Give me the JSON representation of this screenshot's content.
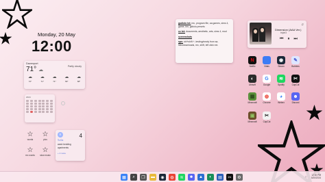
{
  "clock": {
    "date": "Monday, 20 May",
    "time": "12:00"
  },
  "weather": {
    "location": "Davenport",
    "temp": "71°",
    "condition": "Partly cloudy",
    "icon": "partly-cloudy-icon",
    "forecast": [
      {
        "label": "72°",
        "icon": "cloud-icon"
      },
      {
        "label": "71°",
        "icon": "cloud-icon"
      },
      {
        "label": "71°",
        "icon": "cloud-icon"
      },
      {
        "label": "69°",
        "icon": "cloud-icon"
      },
      {
        "label": "68°",
        "icon": "cloud-icon"
      }
    ]
  },
  "calendar": {
    "header": "2024",
    "today_index": 29
  },
  "star_grid": {
    "items": [
      {
        "label": "words",
        "icon": "star-icon"
      },
      {
        "label": "pics",
        "icon": "star-icon"
      },
      {
        "label": "rec words",
        "icon": "star-icon"
      },
      {
        "label": "slow music",
        "icon": "star-icon"
      }
    ]
  },
  "reminder": {
    "count": "4",
    "list_name": "To Do",
    "items": [
      "wash bedding",
      "apartments"
    ],
    "more": "+ 2 more"
  },
  "notes": {
    "lines": [
      {
        "head": "gudiolo txt:",
        "body": "rec, program file, aa games, sims 4, game, bin, gidiolo presets"
      },
      {
        "head": "cc txt:",
        "body": "documents, aesthetic, arts, sims 4, mod"
      },
      {
        "head": "screenshots",
        "body": ""
      },
      {
        "head": "sps:",
        "body": "ctrl+shift +, testing/newly from sa-files/downloads, rec, shift, left click ext."
      }
    ]
  },
  "music": {
    "title": "Dimension (AAA Ver.)",
    "artist": "triple3",
    "note_icon": "music-note-icon",
    "controls": [
      "previous-icon",
      "pause-icon",
      "next-icon"
    ]
  },
  "desktop_icons": [
    {
      "label": "Netflix",
      "color": "#111111",
      "glyph": "N",
      "fg": "#e50914"
    },
    {
      "label": "Vitals",
      "color": "#3d7cf5",
      "glyph": "",
      "fg": "#ffffff"
    },
    {
      "label": "Steam",
      "color": "#1b2838",
      "glyph": "◉",
      "fg": "#ffffff"
    },
    {
      "label": "Bubbles",
      "color": "#dfe6ff",
      "glyph": "✎",
      "fg": "#4a5bd1"
    },
    {
      "label": "Ubisoft",
      "color": "#2b2b2b",
      "glyph": "◐",
      "fg": "#ffffff"
    },
    {
      "label": "Google",
      "color": "#ffffff",
      "glyph": "G",
      "fg": "#3b82f6"
    },
    {
      "label": "Spotify",
      "color": "#1ed760",
      "glyph": "≋",
      "fg": "#ffffff"
    },
    {
      "label": "CapCut",
      "color": "#111111",
      "glyph": "✂",
      "fg": "#ffffff"
    },
    {
      "label": "Minecraft",
      "color": "#5a8f3c",
      "glyph": "▦",
      "fg": "#2d4a1c"
    },
    {
      "label": "Chrome",
      "color": "#ffffff",
      "glyph": "◍",
      "fg": "#ea4335"
    },
    {
      "label": "Webex",
      "color": "#ffffff",
      "glyph": "◕",
      "fg": "#3b82f6"
    },
    {
      "label": "Discord",
      "color": "#5865f2",
      "glyph": "☻",
      "fg": "#ffffff"
    },
    {
      "label": "Minecraft",
      "color": "#6b4f2a",
      "glyph": "▣",
      "fg": "#90c060"
    },
    {
      "label": "CapCut",
      "color": "#f2f2f2",
      "glyph": "✂",
      "fg": "#111111"
    }
  ],
  "taskbar": {
    "icons": [
      {
        "name": "start-icon",
        "color": "#3b82f6",
        "glyph": "▦"
      },
      {
        "name": "search-icon",
        "color": "#444444",
        "glyph": "⌕"
      },
      {
        "name": "task-view-icon",
        "color": "#555555",
        "glyph": "❐"
      },
      {
        "name": "folder-icon",
        "color": "#e8b93b",
        "glyph": "▬"
      },
      {
        "name": "steam-icon",
        "color": "#1b2838",
        "glyph": "◉"
      },
      {
        "name": "chrome-icon",
        "color": "#ea4335",
        "glyph": "◍"
      },
      {
        "name": "spotify-icon",
        "color": "#1ed760",
        "glyph": "≋"
      },
      {
        "name": "discord-icon",
        "color": "#5865f2",
        "glyph": "☻"
      },
      {
        "name": "photos-icon",
        "color": "#2c6fd1",
        "glyph": "▲"
      },
      {
        "name": "edge-icon",
        "color": "#1a8f5a",
        "glyph": "◐"
      },
      {
        "name": "store-icon",
        "color": "#2b5fb8",
        "glyph": "▤"
      },
      {
        "name": "capcut-icon",
        "color": "#111111",
        "glyph": "✂"
      },
      {
        "name": "settings-icon",
        "color": "#6b6b6b",
        "glyph": "⚙"
      }
    ],
    "time": "12:00 PM",
    "date": "5/20/2024"
  }
}
